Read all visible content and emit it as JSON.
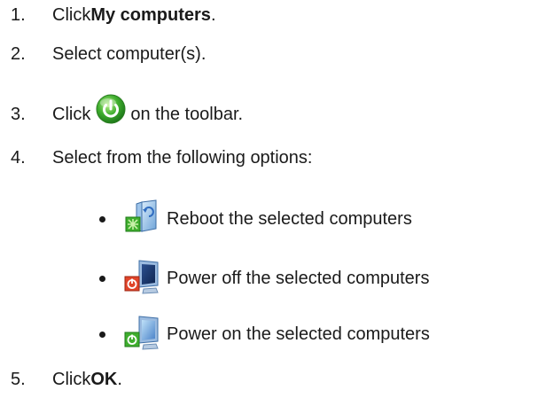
{
  "steps": [
    {
      "number": "1.",
      "prefix": "Click ",
      "bold": "My computers",
      "suffix": "."
    },
    {
      "number": "2.",
      "text": "Select computer(s)."
    },
    {
      "number": "3.",
      "prefix": "Click",
      "suffix": "on the toolbar.",
      "icon": "power-icon"
    },
    {
      "number": "4.",
      "text": "Select from the following options:"
    },
    {
      "number": "5.",
      "prefix": "Click ",
      "bold": "OK",
      "suffix": "."
    }
  ],
  "options": [
    {
      "icon": "reboot-computer-icon",
      "label": "Reboot the selected computers"
    },
    {
      "icon": "power-off-computer-icon",
      "label": "Power off the selected computers"
    },
    {
      "icon": "power-on-computer-icon",
      "label": "Power on the selected computers"
    }
  ],
  "colors": {
    "text": "#1a1a1a",
    "power_green": "#3fae2e",
    "power_off_red": "#e0442a",
    "monitor_blue": "#4a82c8"
  }
}
